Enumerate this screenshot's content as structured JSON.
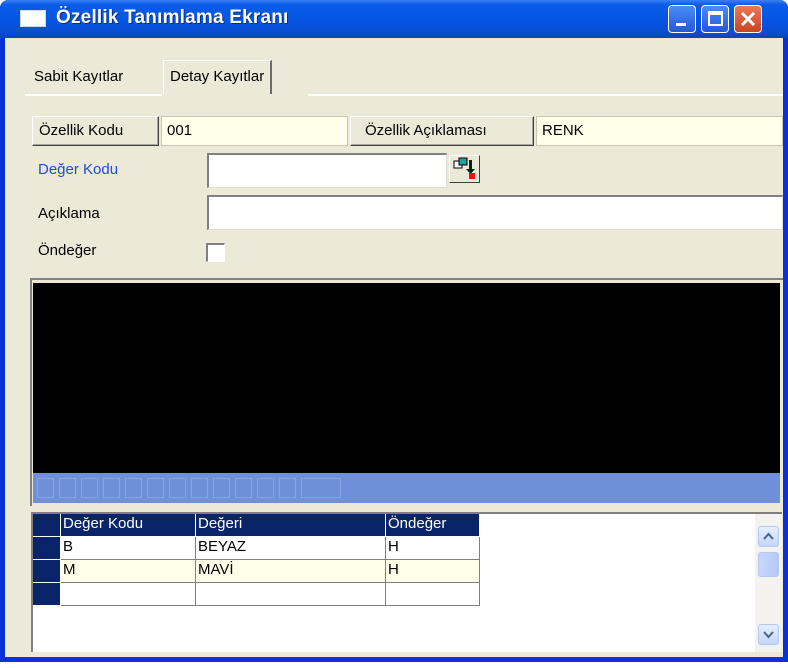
{
  "window": {
    "title": "Özellik Tanımlama Ekranı"
  },
  "tabs": [
    {
      "label": "Sabit Kayıtlar"
    },
    {
      "label": "Detay Kayıtlar"
    }
  ],
  "header_fields": {
    "code_label": "Özellik Kodu",
    "code_value": "001",
    "desc_label": "Özellik Açıklaması",
    "desc_value": "RENK"
  },
  "form": {
    "deger_kodu_label": "Değer Kodu",
    "deger_kodu_value": "",
    "aciklama_label": "Açıklama",
    "aciklama_value": "",
    "ondeger_label": "Öndeğer",
    "ondeger_checked": false
  },
  "colors": {
    "link_label": "#1f4ecf",
    "grid_header": "#0a246a",
    "row_highlight": "#fffee8",
    "title_bar": "#0554e3"
  },
  "grid": {
    "columns": [
      "Değer Kodu",
      "Değeri",
      "Öndeğer"
    ],
    "rows": [
      [
        "B",
        "BEYAZ",
        "H"
      ],
      [
        "M",
        "MAVİ",
        "H"
      ],
      [
        "",
        "",
        ""
      ]
    ]
  }
}
